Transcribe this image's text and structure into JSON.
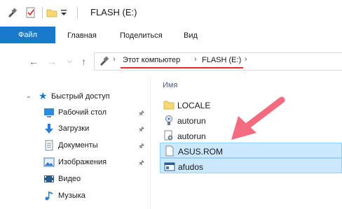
{
  "titlebar": {
    "title": "FLASH (E:)"
  },
  "ribbon": {
    "tabs": [
      "Файл",
      "Главная",
      "Поделиться",
      "Вид"
    ]
  },
  "address": {
    "crumbs": [
      "Этот компьютер",
      "FLASH (E:)"
    ]
  },
  "sidebar": {
    "quick_access": "Быстрый доступ",
    "items": [
      {
        "label": "Рабочий стол",
        "pinned": true
      },
      {
        "label": "Загрузки",
        "pinned": true
      },
      {
        "label": "Документы",
        "pinned": true
      },
      {
        "label": "Изображения",
        "pinned": true
      },
      {
        "label": "Видео",
        "pinned": false
      },
      {
        "label": "Музыка",
        "pinned": false
      }
    ]
  },
  "content": {
    "column_name": "Имя",
    "files": [
      {
        "name": "LOCALE",
        "icon": "folder-icon",
        "selected": false
      },
      {
        "name": "autorun",
        "icon": "autorun-icon",
        "selected": false
      },
      {
        "name": "autorun",
        "icon": "settings-file-icon",
        "selected": false
      },
      {
        "name": "ASUS.ROM",
        "icon": "file-icon",
        "selected": true
      },
      {
        "name": "afudos",
        "icon": "app-icon",
        "selected": true
      }
    ]
  },
  "colors": {
    "accent": "#1979ca",
    "selection": "#cce8ff",
    "highlight": "#e3293a",
    "arrow": "#f36b7e"
  }
}
